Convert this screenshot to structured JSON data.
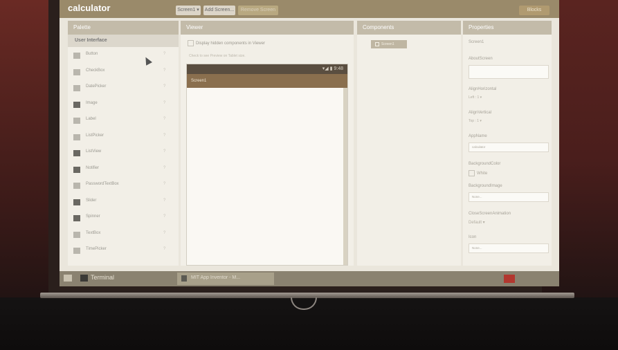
{
  "app": {
    "title": "calculator"
  },
  "toolbar": {
    "screen_select": "Screen1 ▾",
    "add_screen": "Add Screen...",
    "remove_screen": "Remove Screen",
    "right_button": "Blocks"
  },
  "palette": {
    "header": "Palette",
    "section": "User Interface",
    "items": [
      {
        "label": "Button",
        "icon": "button-icon"
      },
      {
        "label": "CheckBox",
        "icon": "checkbox-icon"
      },
      {
        "label": "DatePicker",
        "icon": "datepicker-icon"
      },
      {
        "label": "Image",
        "icon": "image-icon"
      },
      {
        "label": "Label",
        "icon": "label-icon"
      },
      {
        "label": "ListPicker",
        "icon": "listpicker-icon"
      },
      {
        "label": "ListView",
        "icon": "listview-icon"
      },
      {
        "label": "Notifier",
        "icon": "notifier-icon"
      },
      {
        "label": "PasswordTextBox",
        "icon": "password-icon"
      },
      {
        "label": "Slider",
        "icon": "slider-icon"
      },
      {
        "label": "Spinner",
        "icon": "spinner-icon"
      },
      {
        "label": "TextBox",
        "icon": "textbox-icon"
      },
      {
        "label": "TimePicker",
        "icon": "timepicker-icon"
      }
    ],
    "help": "?"
  },
  "viewer": {
    "header": "Viewer",
    "hidden_checkbox_label": "Display hidden components in Viewer",
    "tablet_label": "Check to see Preview on Tablet size.",
    "status_icons": "▾◢ ▮ 9:48",
    "screen_title": "Screen1"
  },
  "components": {
    "header": "Components",
    "items": [
      "Screen1"
    ]
  },
  "properties": {
    "header": "Properties",
    "selected": "Screen1",
    "about_label": "AboutScreen",
    "about_value": "",
    "align_h_label": "AlignHorizontal",
    "align_h_value": "Left : 1 ▾",
    "align_v_label": "AlignVertical",
    "align_v_value": "Top : 1 ▾",
    "appname_label": "AppName",
    "appname_value": "calculator",
    "bg_color_label": "BackgroundColor",
    "bg_color_value": "White",
    "bg_image_label": "BackgroundImage",
    "bg_image_value": "None...",
    "close_anim_label": "CloseScreenAnimation",
    "close_anim_value": "Default ▾",
    "icon_label": "Icon",
    "icon_value": "None..."
  },
  "taskbar": {
    "terminal": "Terminal",
    "browser": "MIT App Inventor - M..."
  },
  "colors": {
    "topbar": "#9a8a6a",
    "panel_header": "#c3bba9",
    "phone_title": "#8a6f4e",
    "taskbar": "#8a8270"
  }
}
